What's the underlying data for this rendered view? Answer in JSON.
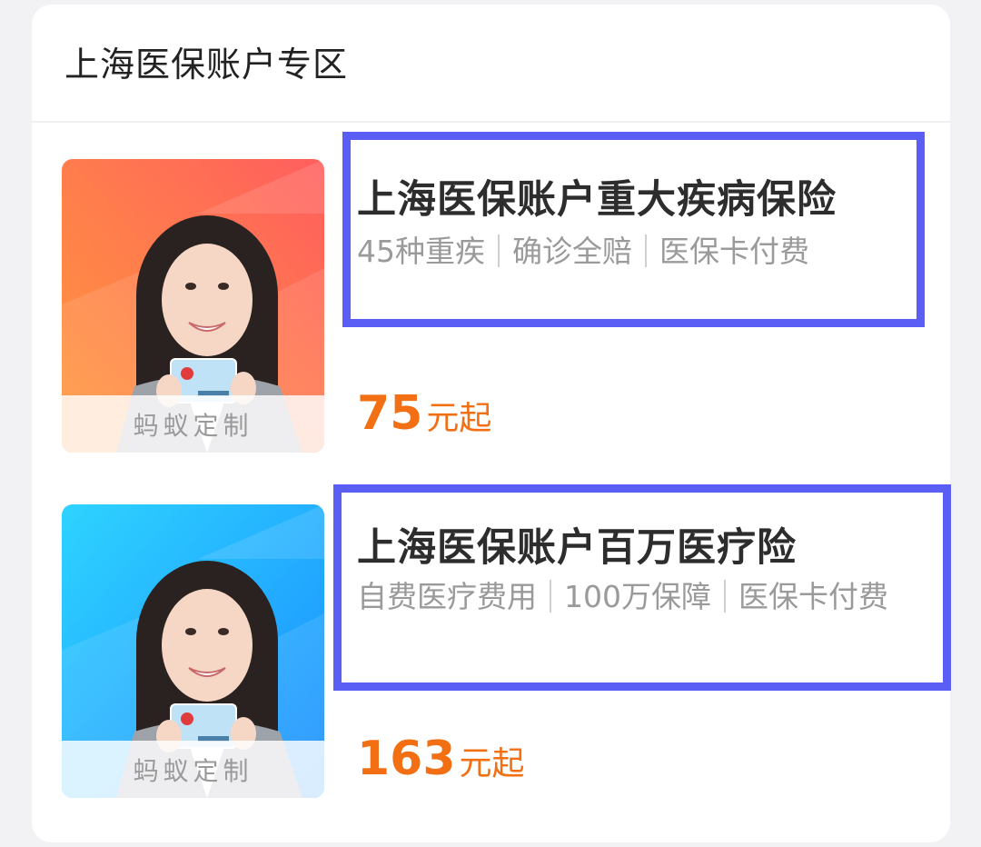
{
  "section": {
    "title": "上海医保账户专区"
  },
  "products": [
    {
      "title": "上海医保账户重大疾病保险",
      "features": [
        "45种重疾",
        "确诊全赔",
        "医保卡付费"
      ],
      "price_value": "75",
      "price_unit": "元起",
      "brand_label": "蚂蚁定制",
      "theme_colors": [
        "#ff9a3c",
        "#ff5e5e"
      ]
    },
    {
      "title": "上海医保账户百万医疗险",
      "features": [
        "自费医疗费用",
        "100万保障",
        "医保卡付费"
      ],
      "price_value": "163",
      "price_unit": "元起",
      "brand_label": "蚂蚁定制",
      "theme_colors": [
        "#2ed3ff",
        "#1a8dff"
      ]
    }
  ],
  "colors": {
    "accent_price": "#f26f13",
    "highlight_border": "#5a5ef5"
  }
}
